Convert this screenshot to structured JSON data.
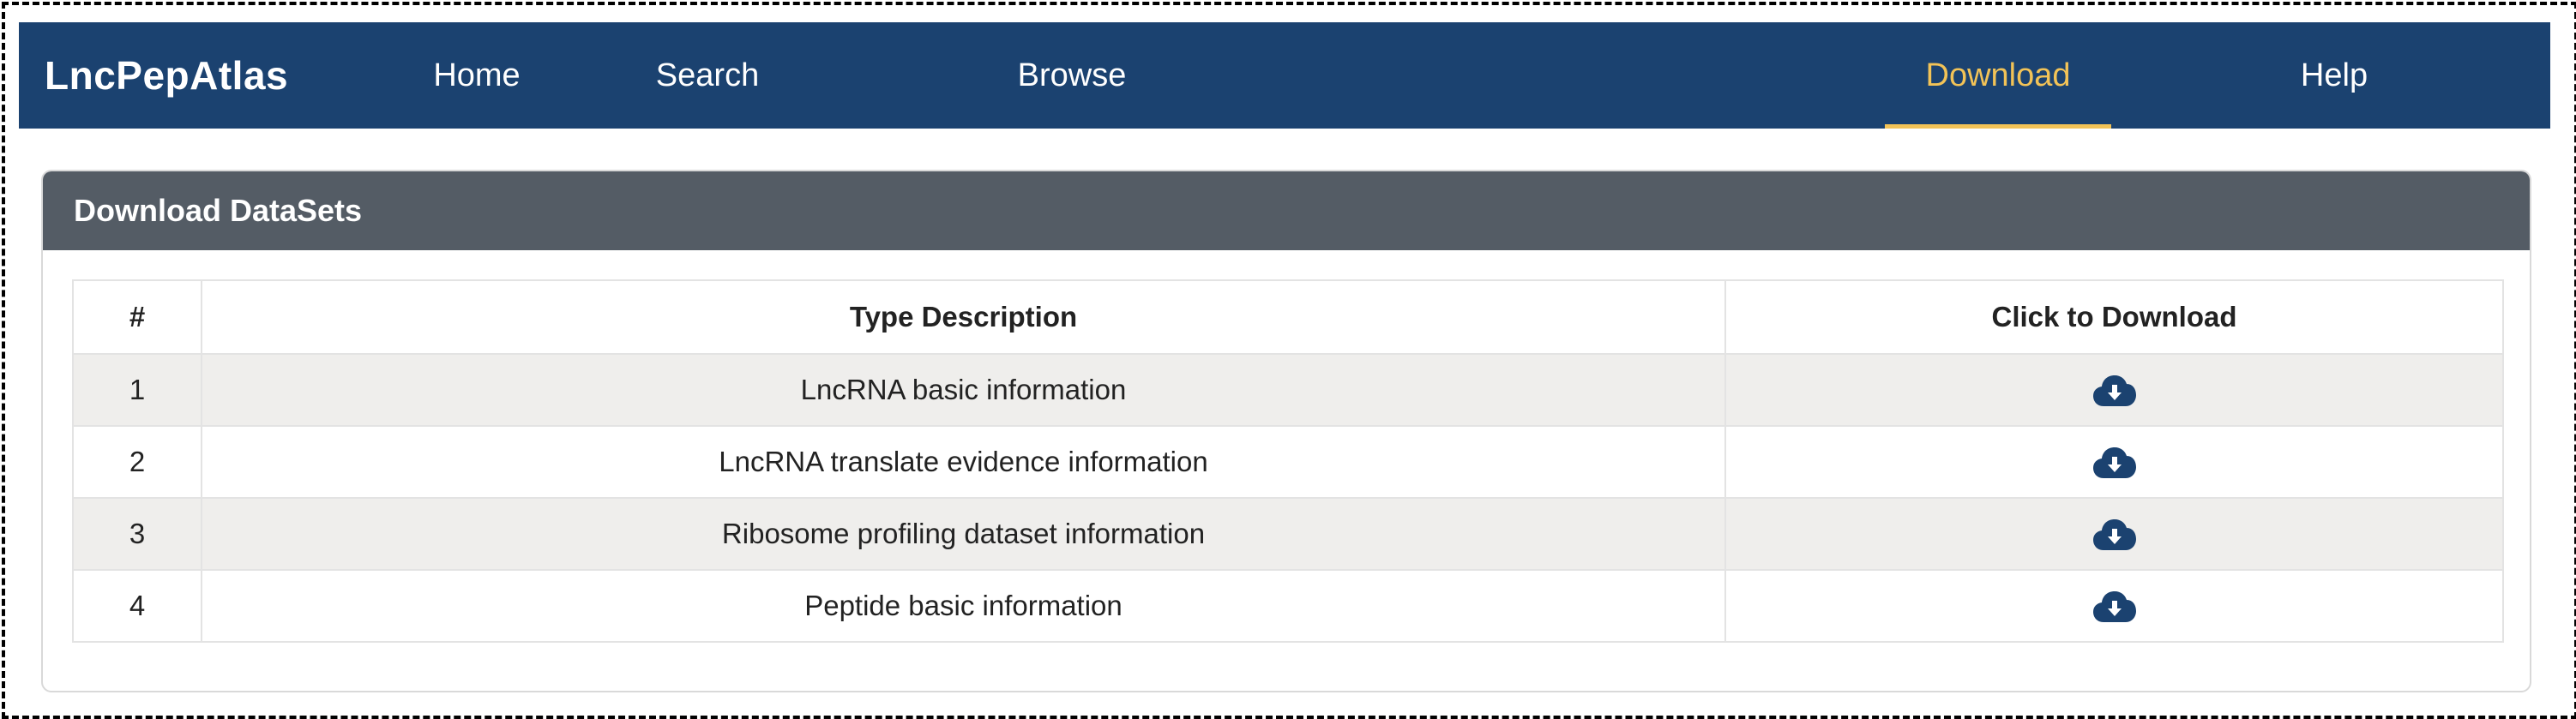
{
  "brand": "LncPepAtlas",
  "nav": {
    "items": [
      {
        "label": "Home"
      },
      {
        "label": "Search"
      },
      {
        "label": "Browse"
      },
      {
        "label": "Download"
      },
      {
        "label": "Help"
      }
    ],
    "active": "Download"
  },
  "panel": {
    "title": "Download DataSets"
  },
  "table": {
    "headers": [
      "#",
      "Type Description",
      "Click to Download"
    ],
    "rows": [
      {
        "num": "1",
        "description": "LncRNA basic information",
        "icon": "cloud-download-icon"
      },
      {
        "num": "2",
        "description": "LncRNA translate evidence information",
        "icon": "cloud-download-icon"
      },
      {
        "num": "3",
        "description": "Ribosome profiling dataset information",
        "icon": "cloud-download-icon"
      },
      {
        "num": "4",
        "description": "Peptide basic information",
        "icon": "cloud-download-icon"
      }
    ]
  },
  "colors": {
    "navbar": "#1b4270",
    "active_nav": "#f2c357",
    "panel_header": "#545c65",
    "icon": "#1b4270",
    "stripe": "#efeeec"
  }
}
